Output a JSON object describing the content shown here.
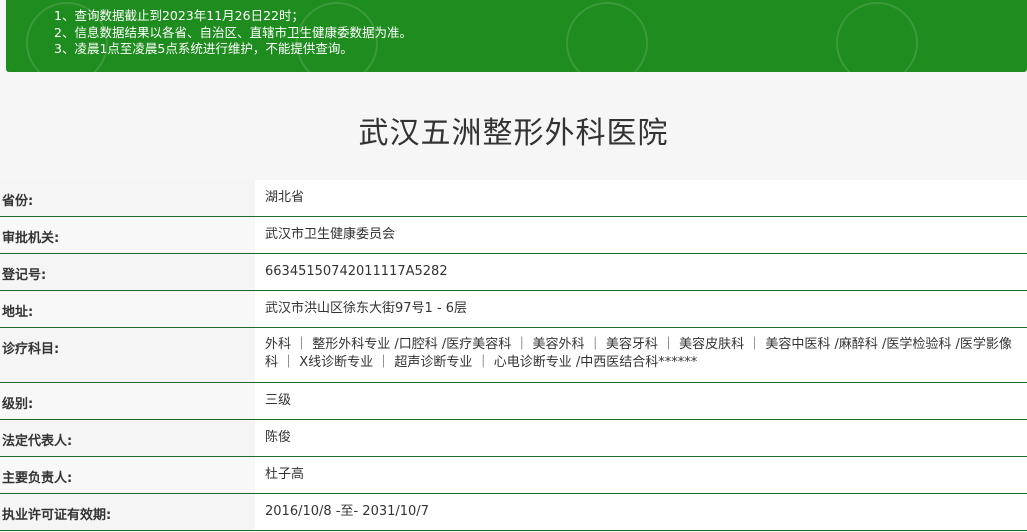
{
  "notice": {
    "lines": [
      "1、查询数据截止到2023年11月26日22时；",
      "2、信息数据结果以各省、自治区、直辖市卫生健康委数据为准。",
      "3、凌晨1点至凌晨5点系统进行维护，不能提供查询。"
    ],
    "background_color": "#1f8c1f"
  },
  "hospital": {
    "title": "武汉五洲整形外科医院"
  },
  "rows": [
    {
      "label": "省份:",
      "value": "湖北省"
    },
    {
      "label": "审批机关:",
      "value": "武汉市卫生健康委员会"
    },
    {
      "label": "登记号:",
      "value": "66345150742011117A5282"
    },
    {
      "label": "地址:",
      "value": "武汉市洪山区徐东大街97号1 - 6层"
    },
    {
      "label": "诊疗科目:",
      "value": "外科 ｜ 整形外科专业 /口腔科 /医疗美容科 ｜ 美容外科 ｜ 美容牙科 ｜ 美容皮肤科 ｜ 美容中医科 /麻醉科 /医学检验科 /医学影像科 ｜ X线诊断专业 ｜ 超声诊断专业 ｜ 心电诊断专业 /中西医结合科******"
    },
    {
      "label": "级别:",
      "value": "三级"
    },
    {
      "label": "法定代表人:",
      "value": "陈俊"
    },
    {
      "label": "主要负责人:",
      "value": "杜子高"
    },
    {
      "label": "执业许可证有效期:",
      "value": "2016/10/8 -至- 2031/10/7"
    }
  ]
}
